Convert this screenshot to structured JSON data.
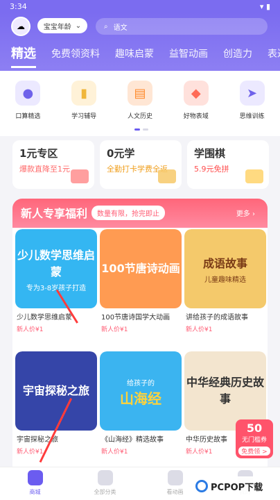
{
  "status": {
    "time": "3:34"
  },
  "header": {
    "grade_selector": "宝宝年龄",
    "search_placeholder": "语文",
    "tabs": [
      "精选",
      "免费领资料",
      "趣味启蒙",
      "益智动画",
      "创造力",
      "表达"
    ]
  },
  "categories": [
    {
      "label": "口算精选",
      "icon": "planet-icon",
      "color": "#6f62ea"
    },
    {
      "label": "学习辅导",
      "icon": "book-icon",
      "color": "#f0b63b"
    },
    {
      "label": "人文历史",
      "icon": "scroll-icon",
      "color": "#ff8a2b"
    },
    {
      "label": "好物表域",
      "icon": "bag-icon",
      "color": "#ff6b57"
    },
    {
      "label": "思维训练",
      "icon": "rocket-icon",
      "color": "#6f62ea"
    }
  ],
  "promos": [
    {
      "title": "1元专区",
      "subtitle": "爆款直降至1元",
      "color": "#ff6b6b"
    },
    {
      "title": "0元学",
      "subtitle": "全勤打卡学费全返",
      "color": "#f0a020"
    },
    {
      "title": "学围棋",
      "subtitle": "5.9元免拼",
      "color": "#ff4d4d"
    }
  ],
  "section": {
    "title": "新人专享福利",
    "badge": "数量有限，抢完即止",
    "more": "更多 ›",
    "items": [
      {
        "cover": "少儿数学思维启蒙",
        "cover_sub": "专为3-8岁孩子打造",
        "name": "少儿数学思维启蒙",
        "price": "新人价¥1",
        "bg": "#34b6f2"
      },
      {
        "cover": "100节唐诗动画",
        "cover_sub": "",
        "name": "100节唐诗国学大动画",
        "price": "新人价¥1",
        "bg": "#ff9b52"
      },
      {
        "cover": "成语故事",
        "cover_sub": "儿童趣味精选",
        "name": "讲给孩子的成语故事",
        "price": "新人价¥1",
        "bg": "#f4c96b"
      },
      {
        "cover": "宇宙探秘之旅",
        "cover_sub": "",
        "name": "宇宙探秘之旅",
        "price": "新人价¥1",
        "bg": "#3545a8"
      },
      {
        "cover": "山海经",
        "cover_sub": "给孩子的",
        "name": "《山海经》精选故事",
        "price": "新人价¥1",
        "bg": "#3bb4f0"
      },
      {
        "cover": "中华经典历史故事",
        "cover_sub": "",
        "name": "中华历史故事",
        "price": "新人价¥1",
        "bg": "#f3e5cf"
      }
    ]
  },
  "coupon": {
    "amount": "50",
    "label": "无门槛券",
    "action": "免费领 >"
  },
  "bottom_nav": [
    {
      "label": "商城",
      "icon": "home-icon",
      "active": true
    },
    {
      "label": "全部分类",
      "icon": "grid-icon",
      "active": false
    },
    {
      "label": "看动画",
      "icon": "tv-icon",
      "active": false
    },
    {
      "label": "我的",
      "icon": "user-icon",
      "active": false
    }
  ],
  "watermark": "PCPOP下载"
}
